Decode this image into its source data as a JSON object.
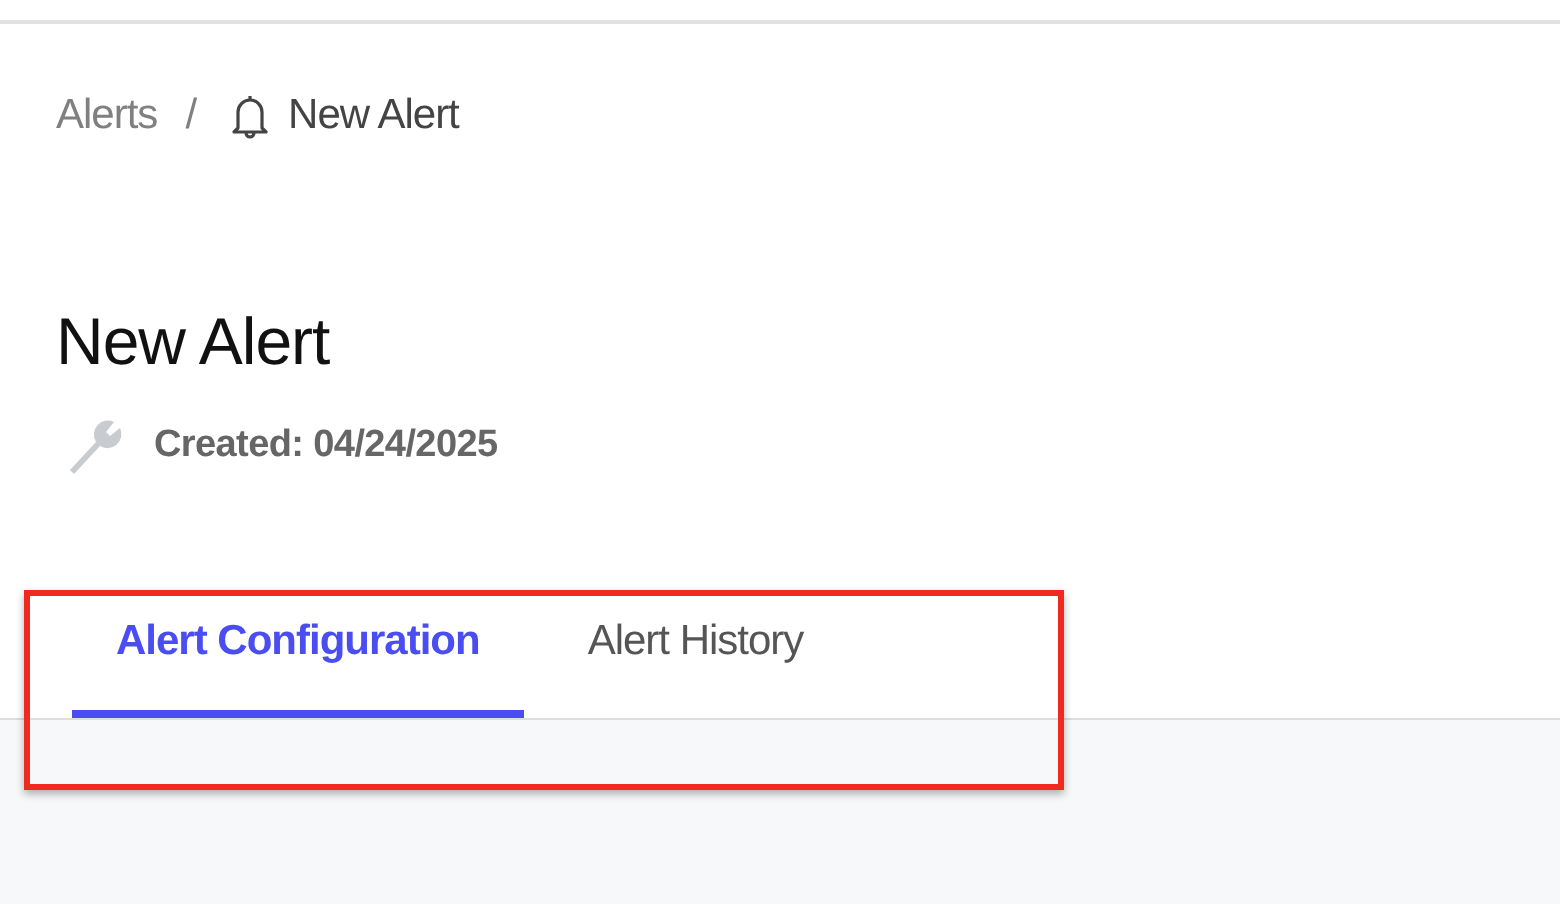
{
  "breadcrumb": {
    "parent": "Alerts",
    "separator": "/",
    "current": "New Alert"
  },
  "title": "New Alert",
  "created": "Created: 04/24/2025",
  "tabs": [
    {
      "label": "Alert Configuration",
      "selected": true
    },
    {
      "label": "Alert History",
      "selected": false
    }
  ]
}
